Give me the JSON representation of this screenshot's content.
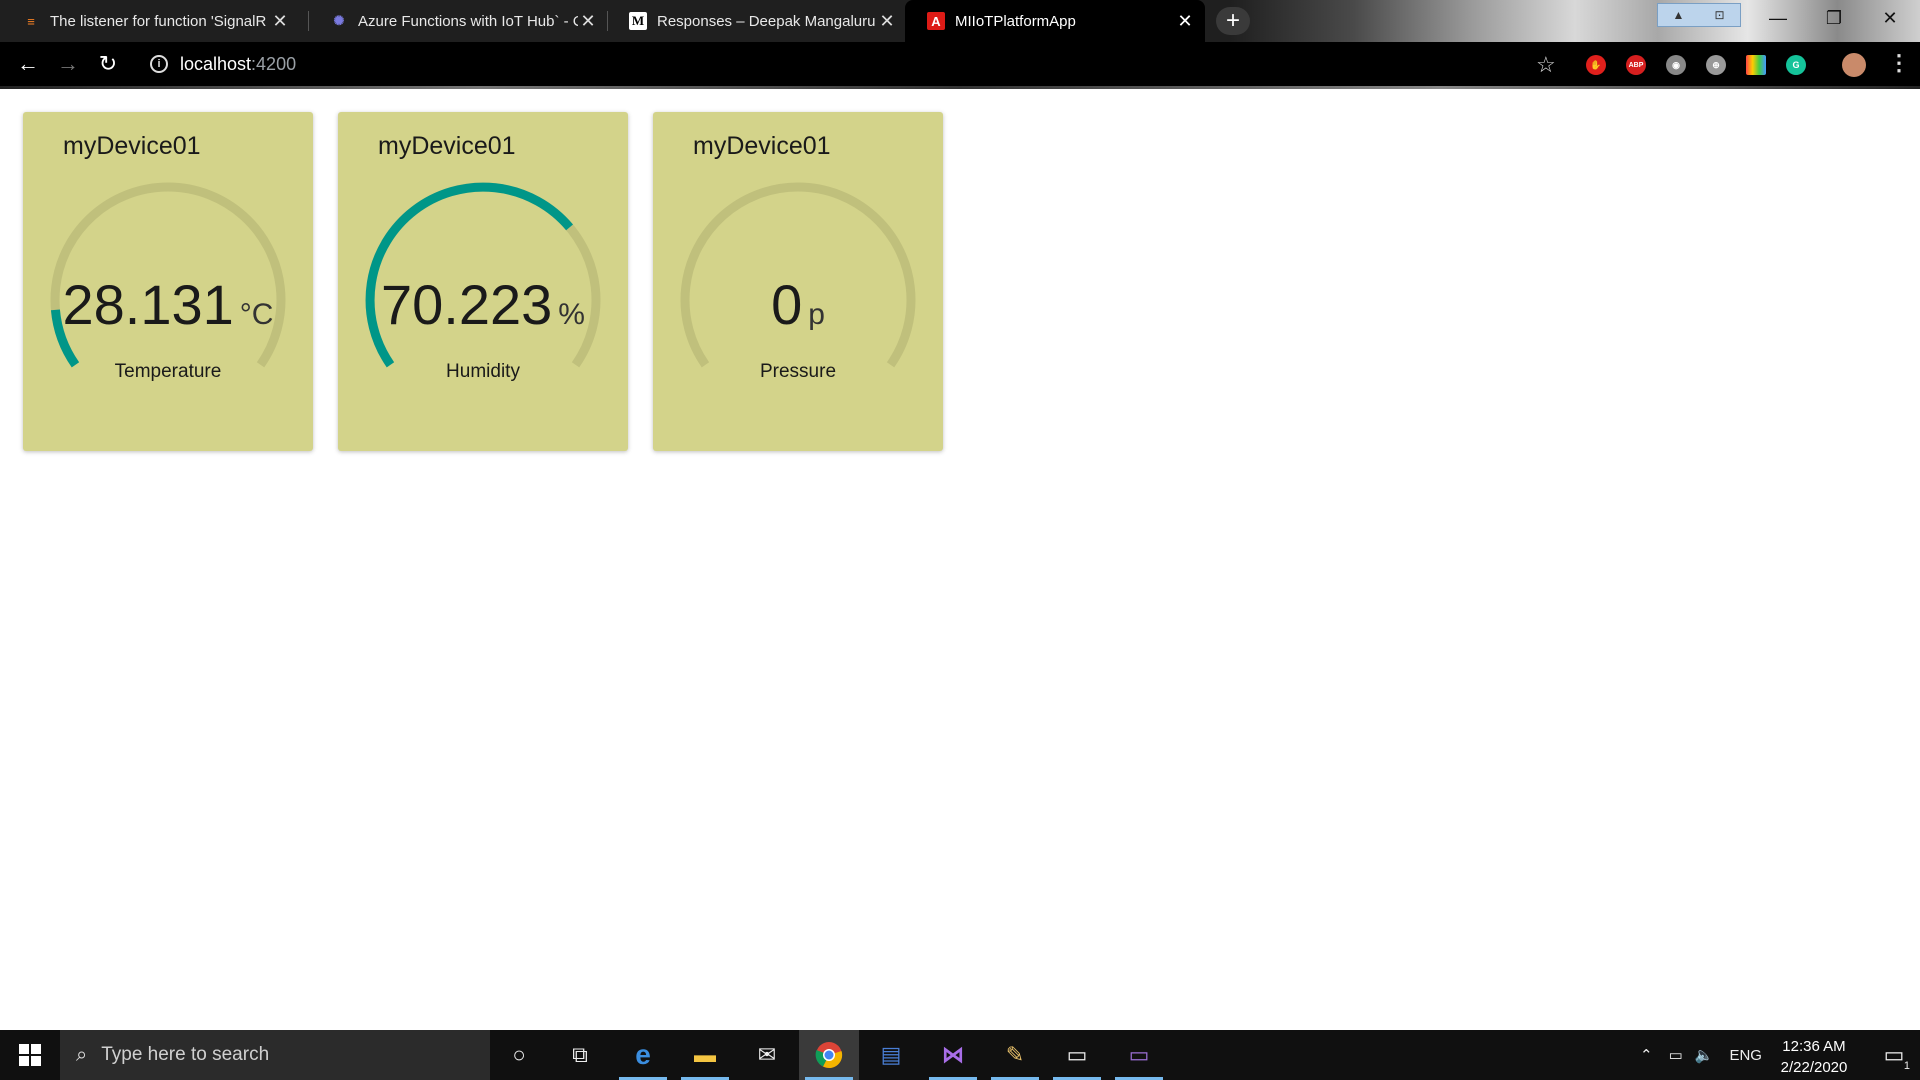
{
  "browser": {
    "tabs": [
      {
        "title": "The listener for function 'SignalR",
        "favicon": "stackoverflow-icon",
        "active": false
      },
      {
        "title": "Azure Functions with IoT Hub` - C",
        "favicon": "azure-icon",
        "active": false
      },
      {
        "title": "Responses – Deepak Mangaluru",
        "favicon": "medium-icon",
        "active": false
      },
      {
        "title": "MIIoTPlatformApp",
        "favicon": "angular-icon",
        "active": true
      }
    ],
    "url_host": "localhost",
    "url_port": ":4200",
    "extensions": [
      "adblock-icon",
      "abp-icon",
      "camera-icon",
      "globe-icon",
      "color-grid-icon",
      "grammarly-icon",
      "avatar"
    ],
    "abp_label": "ABP"
  },
  "gauges": [
    {
      "device": "myDevice01",
      "value": "28.131",
      "unit": "°C",
      "label": "Temperature",
      "fraction": 0.12
    },
    {
      "device": "myDevice01",
      "value": "70.223",
      "unit": "%",
      "label": "Humidity",
      "fraction": 0.7
    },
    {
      "device": "myDevice01",
      "value": "0",
      "unit": "p",
      "label": "Pressure",
      "fraction": 0.0
    }
  ],
  "colors": {
    "card_bg": "#d3d38a",
    "gauge_track": "#c0c07c",
    "gauge_fill": "#009688"
  },
  "taskbar": {
    "search_placeholder": "Type here to search",
    "language": "ENG",
    "time": "12:36 AM",
    "date": "2/22/2020",
    "notification_count": "1"
  }
}
